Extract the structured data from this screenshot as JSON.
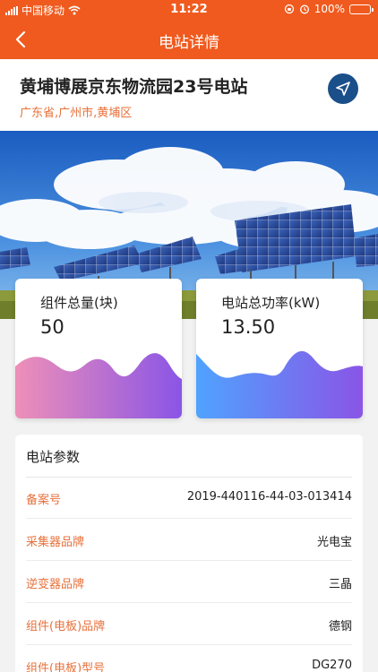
{
  "status_bar": {
    "carrier": "中国移动",
    "time": "11:22",
    "battery_percent": "100%",
    "battery_level": 1.0
  },
  "nav": {
    "title": "电站详情",
    "back_icon": "chevron-left-icon"
  },
  "station": {
    "name": "黄埔博展京东物流园23号电站",
    "address": "广东省,广州市,黄埔区",
    "navigate_icon": "navigation-arrow-icon"
  },
  "stats": [
    {
      "label": "组件总量(块)",
      "value": "50"
    },
    {
      "label": "电站总功率(kW)",
      "value": "13.50"
    }
  ],
  "params": {
    "title": "电站参数",
    "rows": [
      {
        "key": "备案号",
        "value": "2019-440116-44-03-013414"
      },
      {
        "key": "采集器品牌",
        "value": "光电宝"
      },
      {
        "key": "逆变器品牌",
        "value": "三晶"
      },
      {
        "key": "组件(电板)品牌",
        "value": "德钢"
      },
      {
        "key": "组件(电板)型号",
        "value": "DG270"
      }
    ]
  },
  "colors": {
    "brand": "#f05a1e",
    "accent_text": "#e8703a",
    "nav_button": "#1b4f8a"
  }
}
